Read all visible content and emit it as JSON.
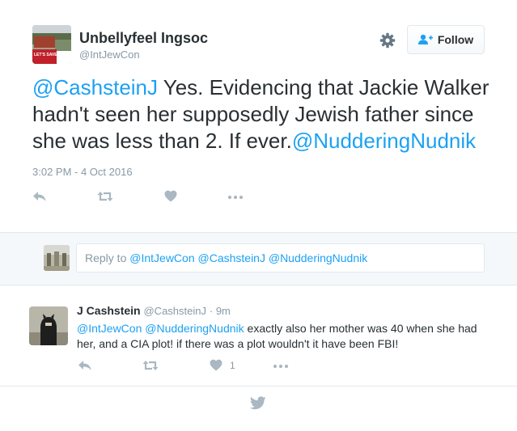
{
  "main_tweet": {
    "display_name": "Unbellyfeel Ingsoc",
    "handle": "@IntJewCon",
    "follow_label": "Follow",
    "text_mention_start": "@CashsteinJ",
    "text_body": " Yes. Evidencing that Jackie Walker hadn't seen her supposedly Jewish father since she was less than 2. If ever.",
    "text_mention_end": "@NudderingNudnik",
    "timestamp": "3:02 PM - 4 Oct 2016",
    "avatar_sign_text": "LET'S SAVE"
  },
  "reply_box": {
    "prefix": "Reply to ",
    "mentions": "@IntJewCon @CashsteinJ @NudderingNudnik"
  },
  "reply_tweet": {
    "display_name": "J Cashstein",
    "handle": "@CashsteinJ",
    "time_ago": "· 9m",
    "mentions": "@IntJewCon @NudderingNudnik",
    "text_body": " exactly also her mother was 40 when she had her, and a CIA plot! if there was a plot wouldn't it have been FBI!",
    "like_count": "1"
  },
  "colors": {
    "accent": "#1da1f2",
    "action_icon": "#aab8c2",
    "muted_text": "#8899a6"
  },
  "icons": [
    "gear-icon",
    "follow-person-plus-icon",
    "reply-icon",
    "retweet-icon",
    "like-heart-icon",
    "more-dots-icon",
    "twitter-bird-icon"
  ]
}
